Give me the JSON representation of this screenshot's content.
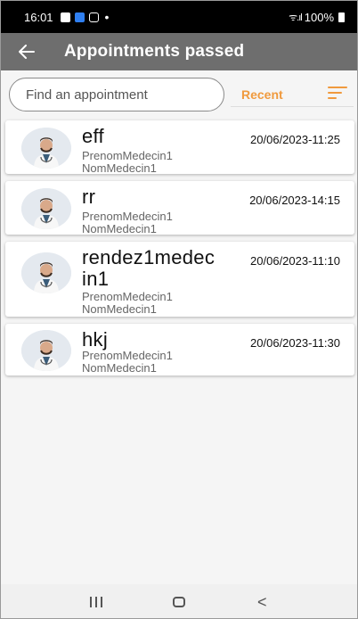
{
  "status_bar": {
    "time": "16:01",
    "dot": "•",
    "signal": "ᯤ.ıl",
    "battery_percent": "100%"
  },
  "app_bar": {
    "back_icon": "arrow-left-icon",
    "title": "Appointments passed"
  },
  "search": {
    "placeholder": "Find an appointment",
    "value": ""
  },
  "sort": {
    "label": "Recent",
    "icon": "sort-lines-icon"
  },
  "colors": {
    "accent": "#f09a3e",
    "app_bar": "#6e6e6e",
    "status_bar": "#000000"
  },
  "appointments": [
    {
      "title": "eff",
      "doctor_first": "PrenomMedecin1",
      "doctor_last": "NomMedecin1",
      "date": "20/06/2023-11:25"
    },
    {
      "title": "rr",
      "doctor_first": "PrenomMedecin1",
      "doctor_last": "NomMedecin1",
      "date": "20/06/2023-14:15"
    },
    {
      "title": "rendez1medecin1",
      "doctor_first": "PrenomMedecin1",
      "doctor_last": "NomMedecin1",
      "date": "20/06/2023-11:10"
    },
    {
      "title": "hkj",
      "doctor_first": "PrenomMedecin1",
      "doctor_last": "NomMedecin1",
      "date": "20/06/2023-11:30"
    }
  ],
  "nav_bar": {
    "back_glyph": "<"
  }
}
